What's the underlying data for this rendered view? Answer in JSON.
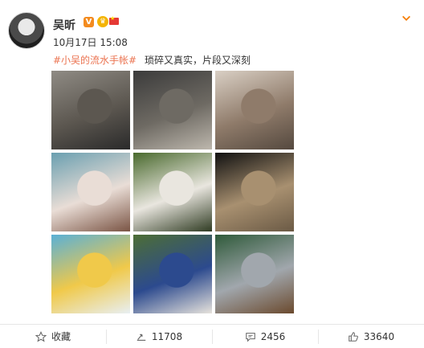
{
  "user": {
    "name": "吴昕",
    "verified_icon": "v-verified-icon",
    "badge_icon": "vip-crown-icon",
    "flag_icon": "china-flag-icon"
  },
  "post": {
    "time": "10月17日 15:08",
    "topic": "#小吴的流水手帐#",
    "text": "琐碎又真实，片段又深刻"
  },
  "photos": [
    {
      "name": "photo-woman-wall",
      "colors": [
        "#8f8b84",
        "#5c5750",
        "#2a2a2a"
      ]
    },
    {
      "name": "photo-husky-dogs",
      "colors": [
        "#3b3b3b",
        "#6e6a63",
        "#bdb7ad"
      ]
    },
    {
      "name": "photo-woman-scarf",
      "colors": [
        "#d9cfc4",
        "#8f7b6a",
        "#55493f"
      ]
    },
    {
      "name": "photo-woman-drink",
      "colors": [
        "#6a9fb0",
        "#e9ddd6",
        "#7a5444"
      ]
    },
    {
      "name": "photo-white-dog",
      "colors": [
        "#4a6a2e",
        "#e9e6df",
        "#2f3b22"
      ]
    },
    {
      "name": "photo-town-square",
      "colors": [
        "#111111",
        "#a89070",
        "#6b5a45"
      ]
    },
    {
      "name": "photo-lemon-drink",
      "colors": [
        "#5ab0d6",
        "#f0c94a",
        "#e8eff3"
      ]
    },
    {
      "name": "photo-dog-people",
      "colors": [
        "#4d6e35",
        "#2c4a8e",
        "#e7e3dc"
      ]
    },
    {
      "name": "photo-lake-forest",
      "colors": [
        "#2f5a3a",
        "#a1a7ad",
        "#6b4a2e"
      ]
    }
  ],
  "actions": {
    "favorite_label": "收藏",
    "repost_count": "11708",
    "comment_count": "2456",
    "like_count": "33640"
  }
}
